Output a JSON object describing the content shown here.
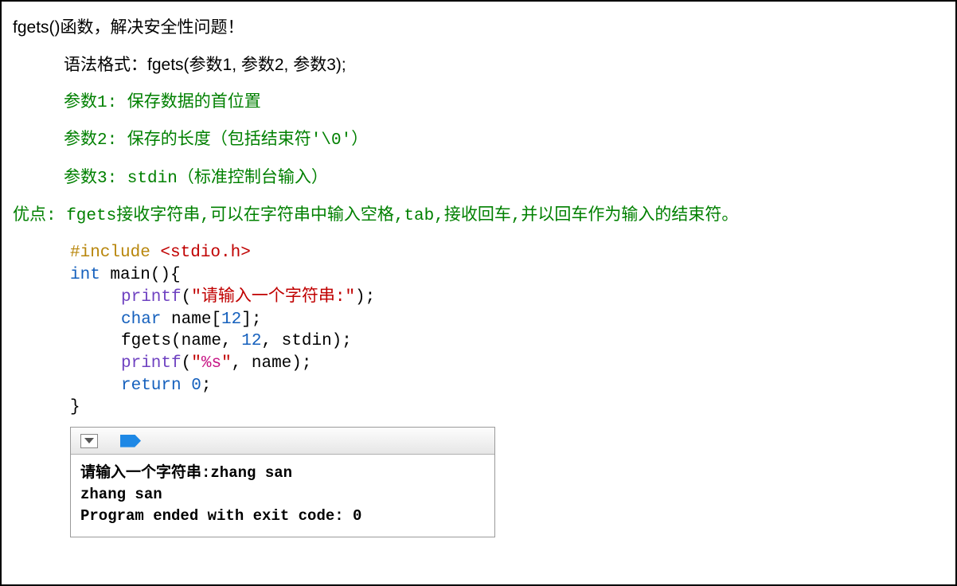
{
  "title_line": "fgets()函数，解决安全性问题！",
  "syntax_line": "语法格式：fgets(参数1, 参数2, 参数3);",
  "param1": "参数1: 保存数据的首位置",
  "param2": "参数2: 保存的长度（包括结束符'\\0'）",
  "param3": "参数3: stdin（标准控制台输入）",
  "advantage": "优点:  fgets接收字符串,可以在字符串中输入空格,tab,接收回车,并以回车作为输入的结束符。",
  "code": {
    "l1a": "#include ",
    "l1b": "<stdio.h>",
    "l2a": "int",
    "l2b": " main(){",
    "l3a": "printf",
    "l3b": "(",
    "l3c": "\"请输入一个字符串:\"",
    "l3d": ");",
    "l4a": "char",
    "l4b": " name[",
    "l4c": "12",
    "l4d": "];",
    "l5a": "fgets(name, ",
    "l5b": "12",
    "l5c": ", stdin);",
    "l6a": "printf",
    "l6b": "(",
    "l6c_open": "\"",
    "l6c_pct": "%s",
    "l6c_close": "\"",
    "l6d": ", name);",
    "l7a": "return",
    "l7b": " ",
    "l7c": "0",
    "l7d": ";",
    "l8": "}"
  },
  "console": {
    "line1": "请输入一个字符串:zhang san",
    "line2": "zhang san",
    "line3": "Program ended with exit code: 0"
  }
}
